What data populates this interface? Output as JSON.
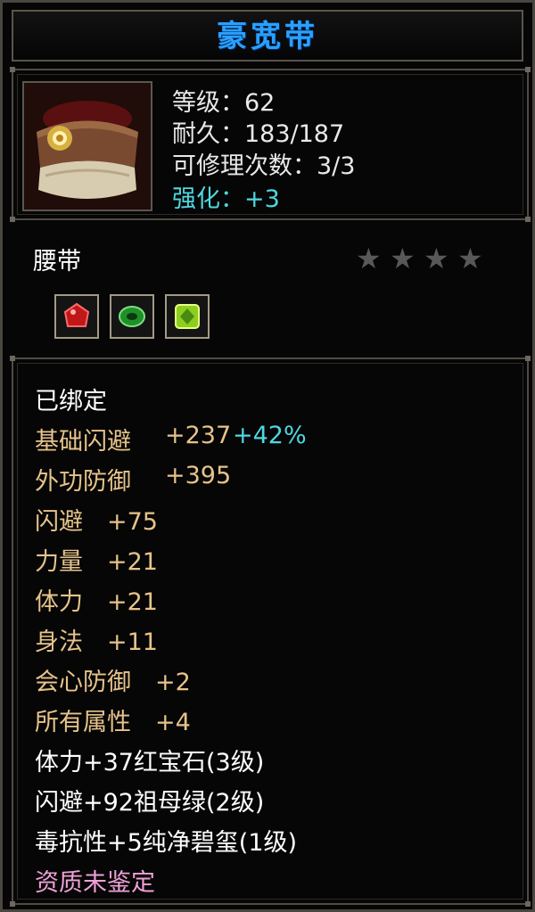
{
  "item": {
    "name": "豪宽带",
    "level": "等级：62",
    "durability": "耐久：183/187",
    "repairs": "可修理次数：3/3",
    "enhance": "强化：+3",
    "type": "腰带",
    "stars_filled": 0,
    "stars_total": 4
  },
  "gems": [
    {
      "name": "ruby-gem-icon",
      "color": "#d01818"
    },
    {
      "name": "emerald-gem-icon",
      "color": "#22a030"
    },
    {
      "name": "jade-gem-icon",
      "color": "#88d020"
    }
  ],
  "attributes": {
    "bound": "已绑定",
    "base_dodge_label": "基础闪避",
    "base_dodge_value": "+237",
    "base_dodge_bonus": "+42%",
    "defense_label": "外功防御",
    "defense_value": "+395",
    "dodge": "闪避　+75",
    "strength": "力量　+21",
    "stamina": "体力　+21",
    "agility": "身法　+11",
    "crit_def": "会心防御　+2",
    "all_attr": "所有属性　+4",
    "gem1": "体力+37红宝石(3级)",
    "gem2": "闪避+92祖母绿(2级)",
    "gem3": "毒抗性+5纯净碧玺(1级)",
    "quality": "资质未鉴定"
  },
  "colors": {
    "title": "#2aa0ff",
    "enhance": "#4fd7e0",
    "gold_attr": "#e6c38a",
    "quality": "#f0a0d8"
  }
}
